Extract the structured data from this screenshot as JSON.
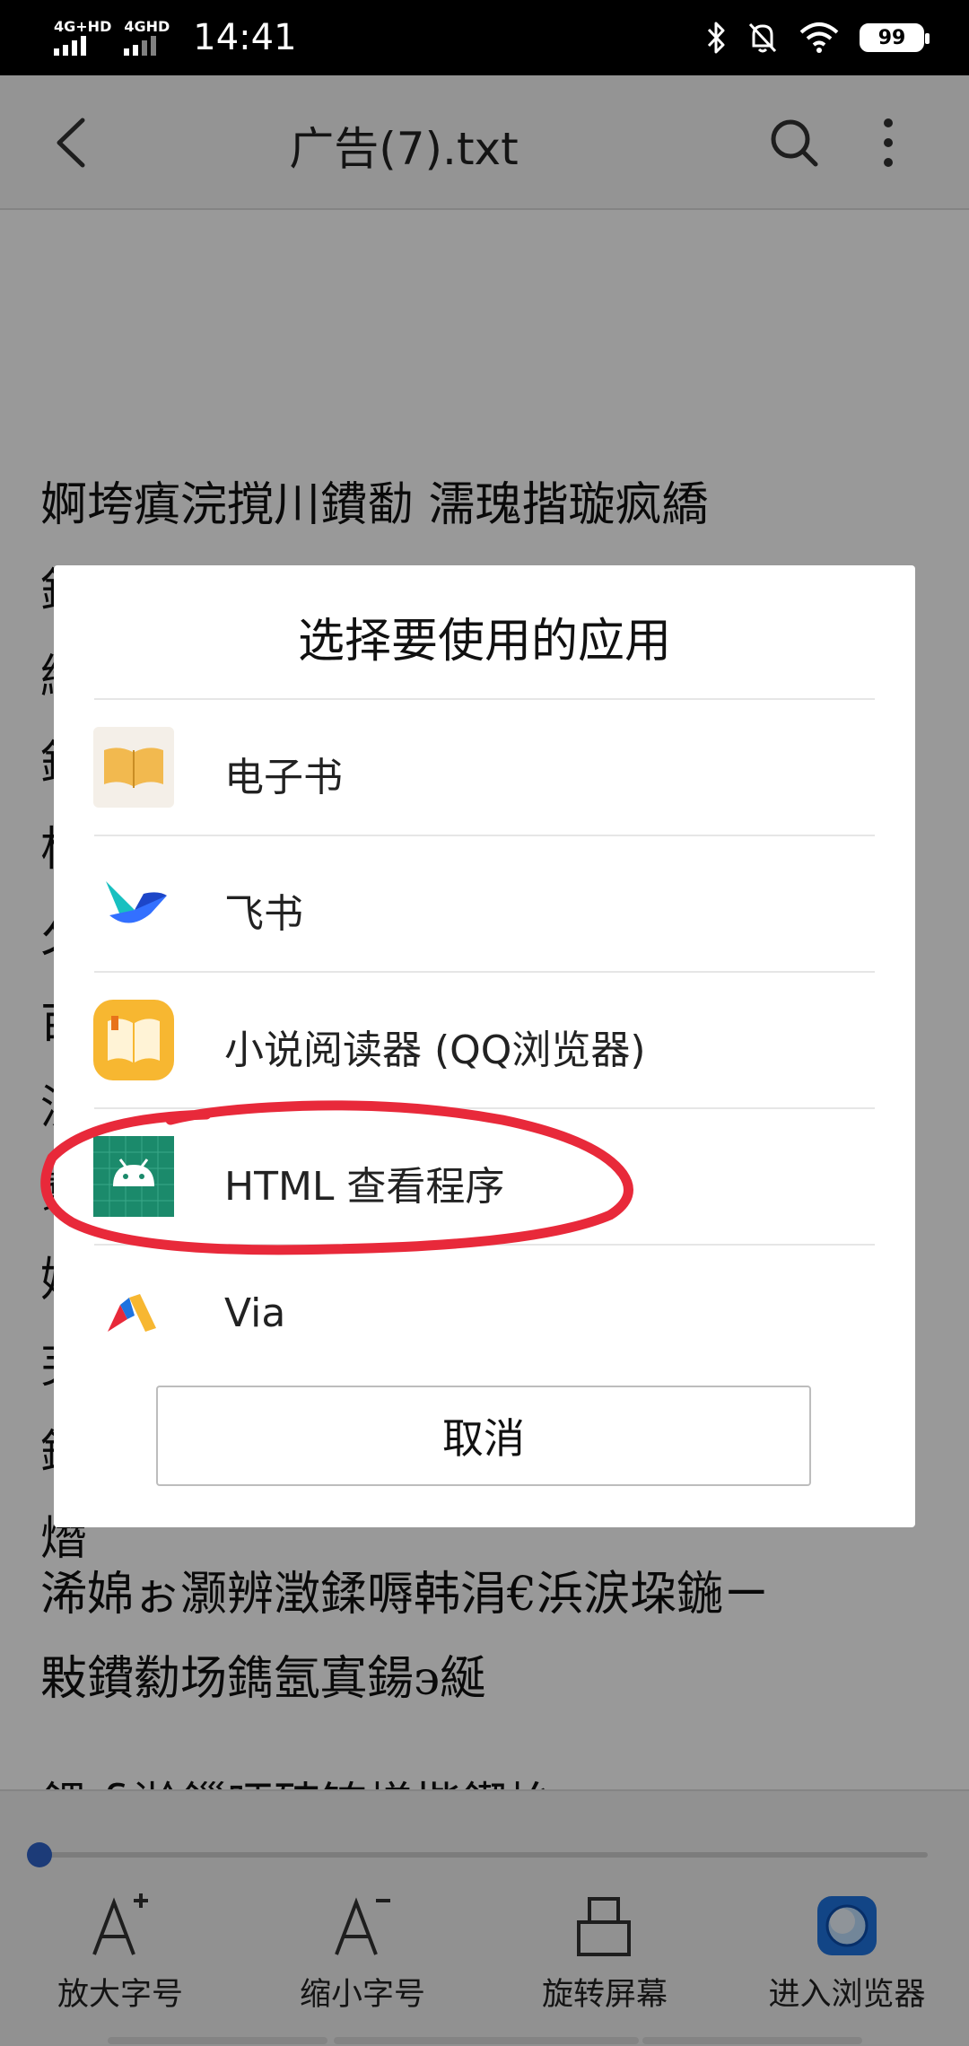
{
  "status_bar": {
    "sim1_label": "4G+HD",
    "sim2_label": "4GHD",
    "time": "14:41",
    "battery": "99",
    "icons": [
      "bluetooth-icon",
      "mute-icon",
      "wifi-icon",
      "battery-icon"
    ]
  },
  "app_bar": {
    "title": "广告(7).txt",
    "icons": [
      "back-icon",
      "search-icon",
      "more-icon"
    ]
  },
  "document": {
    "lines": [
      "婀垮瘨浣撹川鐨勫  濡瑰揩璇疯繑",
      "鈺堛",
      "緢",
      "鈺",
      "杈",
      "夂",
      "亩",
      "沇",
      "翥",
      "婍",
      "芜",
      "鍒",
      "熸",
      "浠婂ぉ灏辨澂鍒嗕韩涓€浜涙垜鍦ㄧ",
      "敤鐨勬场鐫氬寘鍚э綖"
    ],
    "partial_line": "鍝ｆ湁鏁呯殑锛熷揩鍥炲"
  },
  "dialog": {
    "title": "选择要使用的应用",
    "apps": [
      {
        "label": "电子书",
        "icon": "ebook-icon"
      },
      {
        "label": "飞书",
        "icon": "feishu-icon"
      },
      {
        "label": "小说阅读器 (QQ浏览器)",
        "icon": "novel-reader-icon"
      },
      {
        "label": "HTML 查看程序",
        "icon": "android-html-viewer-icon"
      },
      {
        "label": "Via",
        "icon": "via-browser-icon"
      }
    ],
    "cancel_label": "取消"
  },
  "toolbar": {
    "progress_fraction": 0.0,
    "items": [
      {
        "label": "放大字号",
        "icon": "font-increase-icon"
      },
      {
        "label": "缩小字号",
        "icon": "font-decrease-icon"
      },
      {
        "label": "旋转屏幕",
        "icon": "rotate-screen-icon"
      },
      {
        "label": "进入浏览器",
        "icon": "browser-icon"
      }
    ]
  },
  "colors": {
    "accent": "#2f63c8",
    "annotation": "#e8293a",
    "feishu": "#3370ff",
    "html_viewer": "#1b8a6b"
  }
}
